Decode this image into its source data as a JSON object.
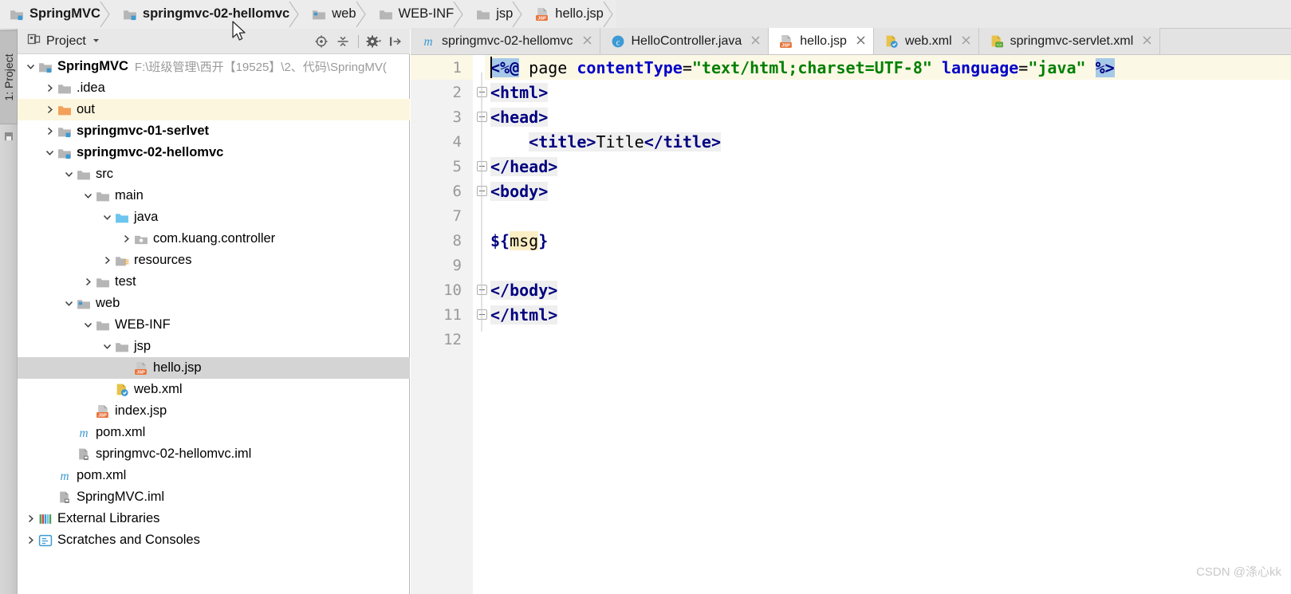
{
  "breadcrumb": {
    "items": [
      {
        "label": "SpringMVC",
        "icon": "module-icon",
        "bold": true
      },
      {
        "label": "springmvc-02-hellomvc",
        "icon": "module-icon",
        "bold": true
      },
      {
        "label": "web",
        "icon": "folder-web-icon",
        "bold": false
      },
      {
        "label": "WEB-INF",
        "icon": "folder-icon",
        "bold": false
      },
      {
        "label": "jsp",
        "icon": "folder-icon",
        "bold": false
      },
      {
        "label": "hello.jsp",
        "icon": "jsp-file-icon",
        "bold": false
      }
    ]
  },
  "tool_strip": {
    "project_tab_label": "1: Project",
    "structure_icon": "structure-icon"
  },
  "project_panel": {
    "title": "Project",
    "title_icon": "project-view-icon",
    "dropdown_icon": "chevron-down-icon",
    "toolbar": [
      {
        "name": "locate-icon",
        "label": "Select Opened File"
      },
      {
        "name": "collapse-all-icon",
        "label": "Collapse All"
      },
      {
        "name": "gear-icon",
        "label": "Settings"
      },
      {
        "name": "hide-panel-icon",
        "label": "Hide"
      }
    ],
    "tree": [
      {
        "depth": 0,
        "twist": "down",
        "icon": "module-icon",
        "label": "SpringMVC",
        "bold": true,
        "path": "F:\\班级管理\\西开【19525】\\2、代码\\SpringMV(",
        "state": "normal"
      },
      {
        "depth": 1,
        "twist": "right",
        "icon": "folder-icon",
        "label": ".idea",
        "bold": false,
        "path": "",
        "state": "normal"
      },
      {
        "depth": 1,
        "twist": "right",
        "icon": "folder-out-icon",
        "label": "out",
        "bold": false,
        "path": "",
        "state": "highlight"
      },
      {
        "depth": 1,
        "twist": "right",
        "icon": "module-icon",
        "label": "springmvc-01-serlvet",
        "bold": true,
        "path": "",
        "state": "normal"
      },
      {
        "depth": 1,
        "twist": "down",
        "icon": "module-icon",
        "label": "springmvc-02-hellomvc",
        "bold": true,
        "path": "",
        "state": "normal"
      },
      {
        "depth": 2,
        "twist": "down",
        "icon": "folder-icon",
        "label": "src",
        "bold": false,
        "path": "",
        "state": "normal"
      },
      {
        "depth": 3,
        "twist": "down",
        "icon": "folder-icon",
        "label": "main",
        "bold": false,
        "path": "",
        "state": "normal"
      },
      {
        "depth": 4,
        "twist": "down",
        "icon": "folder-source-icon",
        "label": "java",
        "bold": false,
        "path": "",
        "state": "normal"
      },
      {
        "depth": 5,
        "twist": "right",
        "icon": "package-icon",
        "label": "com.kuang.controller",
        "bold": false,
        "path": "",
        "state": "normal"
      },
      {
        "depth": 4,
        "twist": "right",
        "icon": "folder-resource-icon",
        "label": "resources",
        "bold": false,
        "path": "",
        "state": "normal"
      },
      {
        "depth": 3,
        "twist": "right",
        "icon": "folder-icon",
        "label": "test",
        "bold": false,
        "path": "",
        "state": "normal"
      },
      {
        "depth": 2,
        "twist": "down",
        "icon": "folder-web-icon",
        "label": "web",
        "bold": false,
        "path": "",
        "state": "normal"
      },
      {
        "depth": 3,
        "twist": "down",
        "icon": "folder-icon",
        "label": "WEB-INF",
        "bold": false,
        "path": "",
        "state": "normal"
      },
      {
        "depth": 4,
        "twist": "down",
        "icon": "folder-icon",
        "label": "jsp",
        "bold": false,
        "path": "",
        "state": "normal"
      },
      {
        "depth": 5,
        "twist": "none",
        "icon": "jsp-file-icon",
        "label": "hello.jsp",
        "bold": false,
        "path": "",
        "state": "selected"
      },
      {
        "depth": 4,
        "twist": "none",
        "icon": "webxml-file-icon",
        "label": "web.xml",
        "bold": false,
        "path": "",
        "state": "normal"
      },
      {
        "depth": 3,
        "twist": "none",
        "icon": "jsp-file-icon",
        "label": "index.jsp",
        "bold": false,
        "path": "",
        "state": "normal"
      },
      {
        "depth": 2,
        "twist": "none",
        "icon": "maven-icon",
        "label": "pom.xml",
        "bold": false,
        "path": "",
        "state": "normal"
      },
      {
        "depth": 2,
        "twist": "none",
        "icon": "iml-file-icon",
        "label": "springmvc-02-hellomvc.iml",
        "bold": false,
        "path": "",
        "state": "normal"
      },
      {
        "depth": 1,
        "twist": "none",
        "icon": "maven-icon",
        "label": "pom.xml",
        "bold": false,
        "path": "",
        "state": "normal"
      },
      {
        "depth": 1,
        "twist": "none",
        "icon": "iml-file-icon",
        "label": "SpringMVC.iml",
        "bold": false,
        "path": "",
        "state": "normal"
      },
      {
        "depth": 0,
        "twist": "right",
        "icon": "libraries-icon",
        "label": "External Libraries",
        "bold": false,
        "path": "",
        "state": "normal"
      },
      {
        "depth": 0,
        "twist": "right",
        "icon": "scratches-icon",
        "label": "Scratches and Consoles",
        "bold": false,
        "path": "",
        "state": "normal"
      }
    ]
  },
  "editor": {
    "tabs": [
      {
        "label": "springmvc-02-hellomvc",
        "icon": "maven-icon",
        "active": false,
        "close_icon": "close-icon"
      },
      {
        "label": "HelloController.java",
        "icon": "java-class-icon",
        "active": false,
        "close_icon": "close-icon"
      },
      {
        "label": "hello.jsp",
        "icon": "jsp-file-icon",
        "active": true,
        "close_icon": "close-icon"
      },
      {
        "label": "web.xml",
        "icon": "webxml-file-icon",
        "active": false,
        "close_icon": "close-icon"
      },
      {
        "label": "springmvc-servlet.xml",
        "icon": "springxml-file-icon",
        "active": false,
        "close_icon": "close-icon"
      }
    ],
    "line_numbers": [
      "1",
      "2",
      "3",
      "4",
      "5",
      "6",
      "7",
      "8",
      "9",
      "10",
      "11",
      "12"
    ],
    "code_lines": [
      "<%@ page contentType=\"text/html;charset=UTF-8\" language=\"java\" %>",
      "<html>",
      "<head>",
      "    <title>Title</title>",
      "</head>",
      "<body>",
      "",
      "${msg}",
      "",
      "</body>",
      "</html>",
      ""
    ],
    "current_line": 1,
    "selection_text": "<%@",
    "folds": [
      2,
      3,
      5,
      6,
      10,
      11
    ]
  },
  "watermark": "CSDN @涤心kk",
  "colors": {
    "tag": "#000080",
    "attribute": "#0000c8",
    "string": "#008000",
    "selection": "#a6c9e8",
    "current_line": "#fcf8e6",
    "el_highlight": "#fbeec4",
    "tree_selected": "#d4d4d4"
  }
}
